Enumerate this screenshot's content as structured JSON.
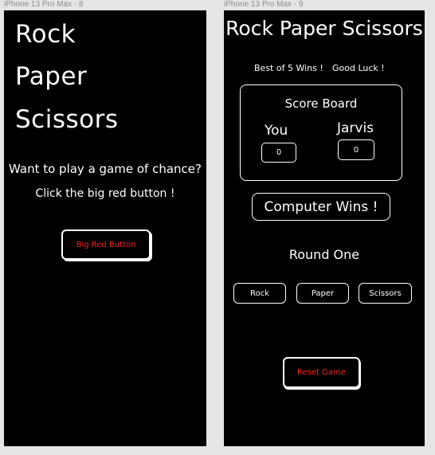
{
  "artboards": {
    "left_label": "iPhone 13 Pro Max - 8",
    "right_label": "iPhone 13 Pro Max - 9"
  },
  "screen8": {
    "title_lines": [
      "Rock",
      "Paper",
      "Scissors"
    ],
    "prompt": "Want to play a game of chance?",
    "instruction": "Click the big red button !",
    "button_label": "Big Red Button"
  },
  "screen9": {
    "title": "Rock Paper Scissors",
    "best_of": "Best of 5 Wins !",
    "good_luck": "Good Luck !",
    "scoreboard": {
      "title": "Score Board",
      "player_name": "You",
      "player_score": "0",
      "opponent_name": "Jarvis",
      "opponent_score": "0"
    },
    "result": "Computer Wins !",
    "round": "Round One",
    "choices": [
      "Rock",
      "Paper",
      "Scissors"
    ],
    "reset_label": "Reset Game"
  },
  "colors": {
    "background": "#e5e5e5",
    "screen": "#000000",
    "text": "#ffffff",
    "accent_red": "#ff1f1f"
  }
}
